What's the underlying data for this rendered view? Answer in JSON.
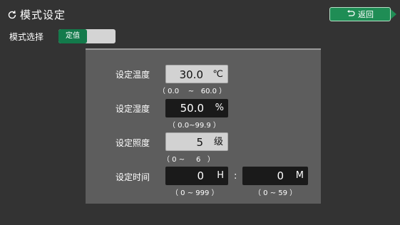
{
  "header": {
    "title": "模式设定",
    "title_icon": "refresh-icon",
    "back_label": "返回",
    "back_icon": "return-arrow-icon"
  },
  "mode": {
    "label": "模式选择",
    "selected": "定值"
  },
  "settings": {
    "temperature": {
      "label": "设定温度",
      "value": "30.0",
      "unit": "℃",
      "range": "（ 0.0    ~   60.0 ）"
    },
    "humidity": {
      "label": "设定湿度",
      "value": "50.0",
      "unit": "%",
      "range": "（ 0.0~99.9 ）"
    },
    "illumination": {
      "label": "设定照度",
      "value": "5",
      "unit": "级",
      "range": "（ 0 ~     6   ）"
    },
    "time": {
      "label": "设定时间",
      "hours": "0",
      "hours_unit": "H",
      "hours_range": "（ 0 ~ 999 ）",
      "separator": ":",
      "minutes": "0",
      "minutes_unit": "M",
      "minutes_range": "（ 0 ~ 59 ）"
    }
  },
  "colors": {
    "background": "#333333",
    "panel": "#5d5d5d",
    "accent_green": "#1f8d55",
    "input_light": "#d2d2d2",
    "input_dark": "#1a1a1a"
  }
}
